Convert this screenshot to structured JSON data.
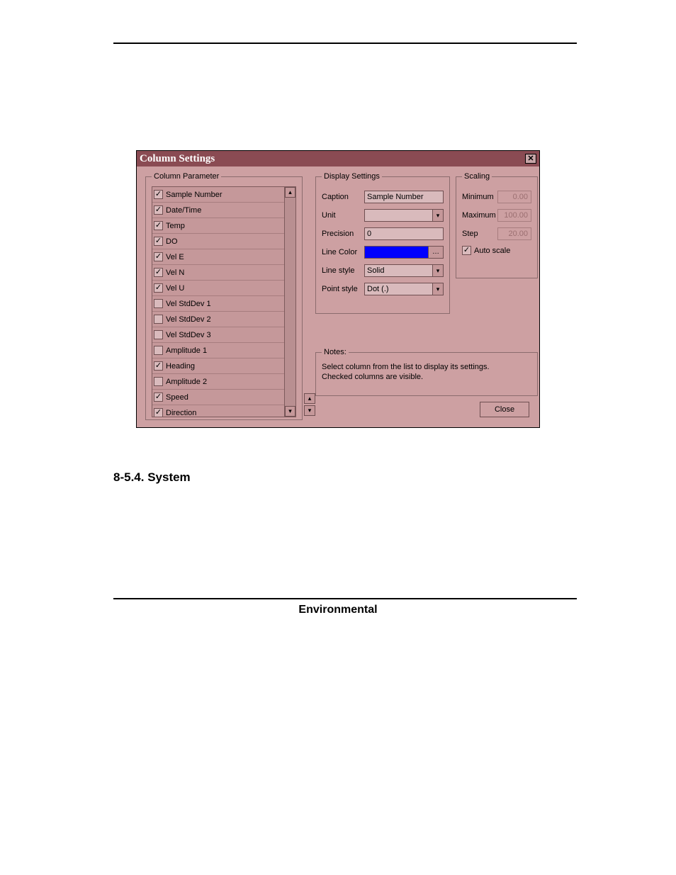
{
  "dialog": {
    "title": "Column Settings",
    "groups": {
      "column_parameter": "Column Parameter",
      "display_settings": "Display Settings",
      "scaling": "Scaling",
      "notes": "Notes:"
    },
    "columns": [
      {
        "label": "Sample Number",
        "checked": true
      },
      {
        "label": "Date/Time",
        "checked": true
      },
      {
        "label": "Temp",
        "checked": true
      },
      {
        "label": "DO",
        "checked": true
      },
      {
        "label": "Vel E",
        "checked": true
      },
      {
        "label": "Vel N",
        "checked": true
      },
      {
        "label": "Vel U",
        "checked": true
      },
      {
        "label": "Vel StdDev 1",
        "checked": false
      },
      {
        "label": "Vel StdDev 2",
        "checked": false
      },
      {
        "label": "Vel StdDev 3",
        "checked": false
      },
      {
        "label": "Amplitude 1",
        "checked": false
      },
      {
        "label": "Heading",
        "checked": true
      },
      {
        "label": "Amplitude 2",
        "checked": false
      },
      {
        "label": "Speed",
        "checked": true
      },
      {
        "label": "Direction",
        "checked": true
      }
    ],
    "display": {
      "caption_label": "Caption",
      "caption_value": "Sample Number",
      "unit_label": "Unit",
      "unit_value": "",
      "precision_label": "Precision",
      "precision_value": "0",
      "linecolor_label": "Line Color",
      "linecolor_value": "#0000ff",
      "linestyle_label": "Line style",
      "linestyle_value": "Solid",
      "pointstyle_label": "Point style",
      "pointstyle_value": "Dot  (.)",
      "color_picker_glyph": "…"
    },
    "scaling": {
      "min_label": "Minimum",
      "min_value": "0.00",
      "max_label": "Maximum",
      "max_value": "100.00",
      "step_label": "Step",
      "step_value": "20.00",
      "auto_label": "Auto scale",
      "auto_checked": true
    },
    "notes_text_1": "Select column from the list to display its settings.",
    "notes_text_2": "Checked columns are visible.",
    "close_label": "Close"
  },
  "section": {
    "heading": "8-5.4.  System"
  },
  "footer": {
    "text": "Environmental"
  },
  "glyphs": {
    "check": "✓",
    "up": "▴",
    "down": "▾",
    "x": "✕"
  }
}
